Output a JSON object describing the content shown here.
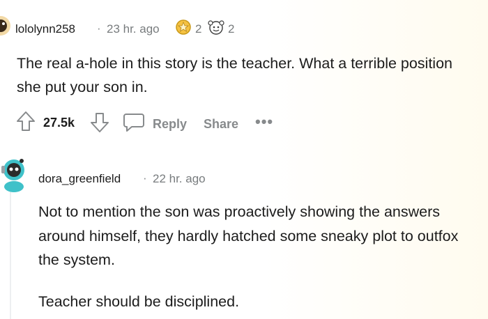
{
  "comments": [
    {
      "username": "lololynn258",
      "time": "23 hr. ago",
      "awards": [
        {
          "icon": "gold-award-icon",
          "count": "2"
        },
        {
          "icon": "wholesome-award-icon",
          "count": "2"
        }
      ],
      "body": "The real a-hole in this story is the teacher. What a terrible position she put your son in.",
      "actions": {
        "score": "27.5k",
        "reply_label": "Reply",
        "share_label": "Share",
        "more_label": "•••"
      }
    },
    {
      "username": "dora_greenfield",
      "time": "22 hr. ago",
      "body_paragraphs": [
        "Not to mention the son was proactively showing the answers around himself, they hardly hatched some sneaky plot to outfox the system.",
        "Teacher should be disciplined."
      ]
    }
  ],
  "separator": "·",
  "colors": {
    "text": "#1c1c1c",
    "meta": "#787c7e",
    "action": "#878a8c",
    "avatar_teal": "#3fc1c9"
  }
}
